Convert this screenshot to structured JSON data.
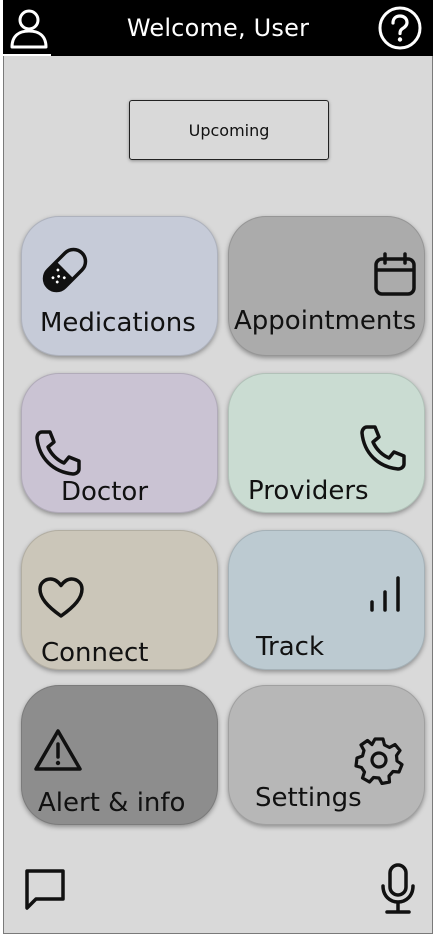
{
  "header": {
    "title": "Welcome, User",
    "profile_icon": "user-icon",
    "help_icon": "help-circle-icon"
  },
  "upcoming": {
    "label": "Upcoming"
  },
  "tiles": [
    {
      "label": "Medications",
      "icon": "pill-icon",
      "color": "#c6cbd8"
    },
    {
      "label": "Appointments",
      "icon": "calendar-icon",
      "color": "#ababab"
    },
    {
      "label": "Doctor",
      "icon": "phone-icon",
      "color": "#cac3d3"
    },
    {
      "label": "Providers",
      "icon": "phone-icon",
      "color": "#cadcd2"
    },
    {
      "label": "Connect",
      "icon": "heart-icon",
      "color": "#cbc6b9"
    },
    {
      "label": "Track",
      "icon": "signal-bars-icon",
      "color": "#bccad1"
    },
    {
      "label": "Alert & info",
      "icon": "warning-icon",
      "color": "#8d8d8d"
    },
    {
      "label": "Settings",
      "icon": "gear-icon",
      "color": "#b7b7b7"
    }
  ],
  "bottom": {
    "chat_icon": "chat-icon",
    "mic_icon": "microphone-icon"
  }
}
